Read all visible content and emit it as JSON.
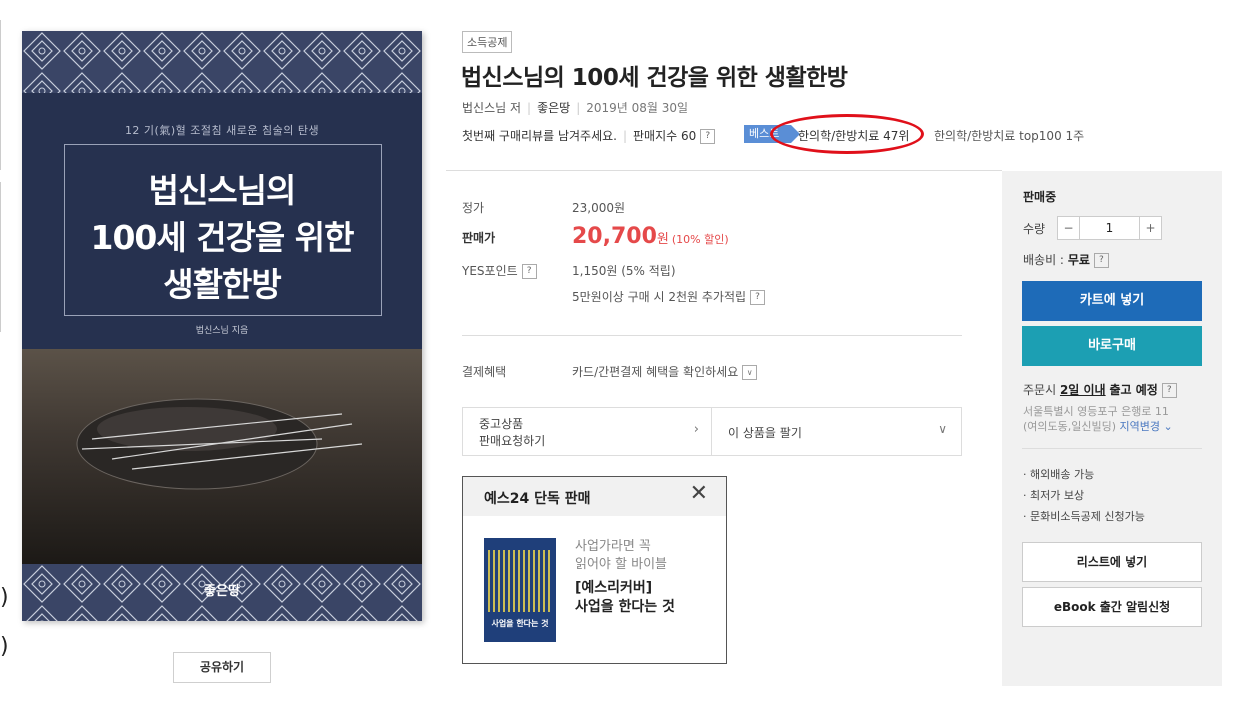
{
  "cover": {
    "subtitle": "12 기(氣)혈 조절침 새로운 침술의 탄생",
    "title_line1": "법신스님의",
    "title_line2": "100세 건강을 위한",
    "title_line3": "생활한방",
    "author": "법신스님 지음",
    "publisher": "좋은땅"
  },
  "share_label": "공유하기",
  "product": {
    "badge": "소득공제",
    "title": "법신스님의 100세 건강을 위한 생활한방",
    "author": "법신스님 저",
    "publisher": "좋은땅",
    "date": "2019년 08월 30일",
    "review_prompt": "첫번째 구매리뷰를 남겨주세요.",
    "sales_index": "판매지수 60",
    "best_tag": "베스트",
    "rank1": "한의학/한방치료 47위",
    "rank2": "한의학/한방치료 top100 1주"
  },
  "price": {
    "list_label": "정가",
    "list_value": "23,000원",
    "sale_label": "판매가",
    "sale_value": "20,700",
    "sale_unit": "원",
    "sale_discount": "(10% 할인)",
    "point_label": "YES포인트",
    "point_value": "1,150원 (5% 적립)",
    "point_extra": "5만원이상 구매 시 2천원 추가적립",
    "benefit_label": "결제혜택",
    "benefit_value": "카드/간편결제 혜택을 확인하세요"
  },
  "used": {
    "line1": "중고상품",
    "line2": "판매요청하기",
    "sell": "이 상품을 팔기"
  },
  "exclusive": {
    "title": "예스24 단독 판매",
    "sub1": "사업가라면 꼭",
    "sub2": "읽어야 할 바이블",
    "main1": "[예스리커버]",
    "main2": "사업을 한다는 것",
    "thumb_text": "사업을 한다는 것"
  },
  "panel": {
    "status": "판매중",
    "qty_label": "수량",
    "qty_minus": "−",
    "qty_value": "1",
    "qty_plus": "+",
    "ship_label": "배송비 :",
    "ship_value": "무료",
    "cart": "카트에 넣기",
    "buy": "바로구매",
    "order_prefix": "주문시",
    "order_days": "2일 이내",
    "order_suffix": "출고 예정",
    "addr1": "서울특별시 영등포구 은행로 11",
    "addr2": "(여의도동,일신빌딩)",
    "region_change": "지역변경",
    "bullets": [
      "해외배송 가능",
      "최저가 보상",
      "문화비소득공제 신청가능"
    ],
    "list_btn": "리스트에 넣기",
    "ebook_btn": "eBook 출간 알림신청"
  }
}
